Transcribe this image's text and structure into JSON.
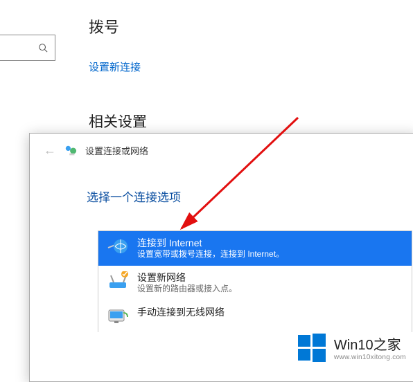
{
  "settings": {
    "dialup_heading": "拨号",
    "new_connection_link": "设置新连接",
    "related_heading": "相关设置"
  },
  "dialog": {
    "title": "设置连接或网络",
    "subtitle": "选择一个连接选项",
    "options": [
      {
        "title": "连接到 Internet",
        "desc": "设置宽带或拨号连接，连接到 Internet。",
        "selected": true,
        "icon": "globe-icon"
      },
      {
        "title": "设置新网络",
        "desc": "设置新的路由器或接入点。",
        "selected": false,
        "icon": "router-icon"
      },
      {
        "title": "手动连接到无线网络",
        "desc": "",
        "selected": false,
        "icon": "monitor-icon"
      }
    ]
  },
  "watermark": {
    "brand": "Win10之家",
    "url": "www.win10xitong.com"
  }
}
